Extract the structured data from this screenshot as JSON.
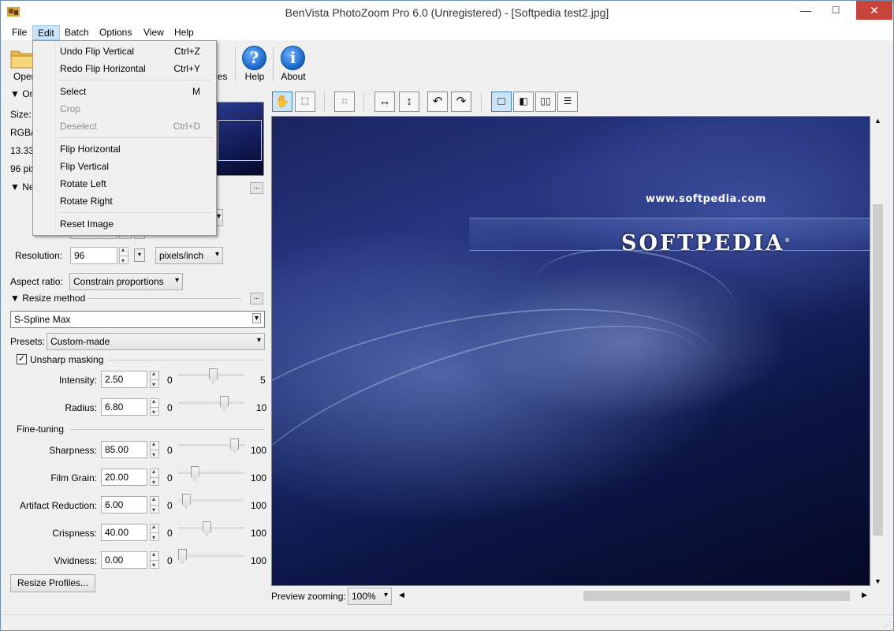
{
  "window": {
    "title": "BenVista PhotoZoom Pro 6.0 (Unregistered) - [Softpedia test2.jpg]",
    "minimize": "—",
    "maximize": "☐",
    "close": "✕"
  },
  "menu": {
    "file": "File",
    "edit": "Edit",
    "batch": "Batch",
    "options": "Options",
    "view": "View",
    "help": "Help"
  },
  "toolbar": {
    "open": "Open",
    "preferences_partial": "ces",
    "help": "Help",
    "about": "About"
  },
  "edit_menu": {
    "undo": {
      "label": "Undo Flip Vertical",
      "key": "Ctrl+Z"
    },
    "redo": {
      "label": "Redo Flip Horizontal",
      "key": "Ctrl+Y"
    },
    "select": {
      "label": "Select",
      "key": "M"
    },
    "crop": {
      "label": "Crop",
      "key": ""
    },
    "deselect": {
      "label": "Deselect",
      "key": "Ctrl+D"
    },
    "flip_h": "Flip Horizontal",
    "flip_v": "Flip Vertical",
    "rot_l": "Rotate Left",
    "rot_r": "Rotate Right",
    "reset": "Reset Image"
  },
  "left": {
    "orig_header": "Or",
    "size": "Size:",
    "rgb": "RGB/",
    "dim": "13.33",
    "dpi": "96 pix",
    "new_header": "Ne",
    "resolution_label": "Resolution:",
    "resolution_value": "96",
    "resolution_unit": "pixels/inch",
    "aspect_label": "Aspect ratio:",
    "aspect_value": "Constrain proportions",
    "resize_method_header": "Resize method",
    "resize_method": "S-Spline Max",
    "presets_label": "Presets:",
    "presets_value": "Custom-made",
    "unsharp_label": "Unsharp masking",
    "unsharp_checked": true,
    "intensity": {
      "label": "Intensity:",
      "value": "2.50",
      "min": "0",
      "max": "5",
      "level": 2.5
    },
    "radius": {
      "label": "Radius:",
      "value": "6.80",
      "min": "0",
      "max": "10",
      "level": 6.8
    },
    "finetuning_header": "Fine-tuning",
    "sharpness": {
      "label": "Sharpness:",
      "value": "85.00",
      "min": "0",
      "max": "100",
      "level": 85
    },
    "filmgrain": {
      "label": "Film Grain:",
      "value": "20.00",
      "min": "0",
      "max": "100",
      "level": 20
    },
    "artifact": {
      "label": "Artifact Reduction:",
      "value": "6.00",
      "min": "0",
      "max": "100",
      "level": 6
    },
    "crispness": {
      "label": "Crispness:",
      "value": "40.00",
      "min": "0",
      "max": "100",
      "level": 40
    },
    "vividness": {
      "label": "Vividness:",
      "value": "0.00",
      "min": "0",
      "max": "100",
      "level": 0
    },
    "resize_profiles": "Resize Profiles...",
    "dots": "..."
  },
  "preview": {
    "url_text": "www.softpedia.com",
    "brand_text": "SOFTPEDIA",
    "tm": "®",
    "zoom_label": "Preview zooming:",
    "zoom_value": "100%"
  }
}
